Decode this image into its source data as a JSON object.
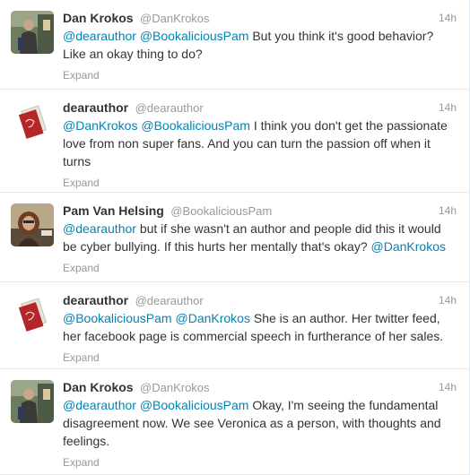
{
  "tweets": [
    {
      "fullname": "Dan Krokos",
      "username": "@DanKrokos",
      "time": "14h",
      "avatar": "dan-avatar",
      "text": [
        {
          "t": "@dearauthor",
          "m": true
        },
        {
          "t": " ",
          "m": false
        },
        {
          "t": "@BookaliciousPam",
          "m": true
        },
        {
          "t": " But you think it's good behavior? Like an okay thing to do?",
          "m": false
        }
      ],
      "expand": "Expand"
    },
    {
      "fullname": "dearauthor",
      "username": "@dearauthor",
      "time": "14h",
      "avatar": "dearauthor-avatar",
      "text": [
        {
          "t": "@DanKrokos",
          "m": true
        },
        {
          "t": " ",
          "m": false
        },
        {
          "t": "@BookaliciousPam",
          "m": true
        },
        {
          "t": " I think you don't get the passionate love from non super fans. And you can turn the passion off when it turns",
          "m": false
        }
      ],
      "expand": "Expand"
    },
    {
      "fullname": "Pam Van Helsing",
      "username": "@BookaliciousPam",
      "time": "14h",
      "avatar": "pam-avatar",
      "text": [
        {
          "t": "@dearauthor",
          "m": true
        },
        {
          "t": " but if she wasn't an author and people did this it would be cyber bullying. If this hurts her mentally that's okay? ",
          "m": false
        },
        {
          "t": "@DanKrokos",
          "m": true
        }
      ],
      "expand": "Expand"
    },
    {
      "fullname": "dearauthor",
      "username": "@dearauthor",
      "time": "14h",
      "avatar": "dearauthor-avatar",
      "text": [
        {
          "t": "@BookaliciousPam",
          "m": true
        },
        {
          "t": " ",
          "m": false
        },
        {
          "t": "@DanKrokos",
          "m": true
        },
        {
          "t": " She is an author. Her twitter feed, her facebook page is commercial speech in furtherance of her sales.",
          "m": false
        }
      ],
      "expand": "Expand"
    },
    {
      "fullname": "Dan Krokos",
      "username": "@DanKrokos",
      "time": "14h",
      "avatar": "dan-avatar",
      "text": [
        {
          "t": "@dearauthor",
          "m": true
        },
        {
          "t": " ",
          "m": false
        },
        {
          "t": "@BookaliciousPam",
          "m": true
        },
        {
          "t": " Okay, I'm seeing the fundamental disagreement now. We see Veronica as a person, with thoughts and feelings.",
          "m": false
        }
      ],
      "expand": "Expand"
    }
  ],
  "colors": {
    "mention": "#0084b4",
    "muted": "#999999",
    "text": "#333333",
    "divider": "#e8e8e8"
  }
}
